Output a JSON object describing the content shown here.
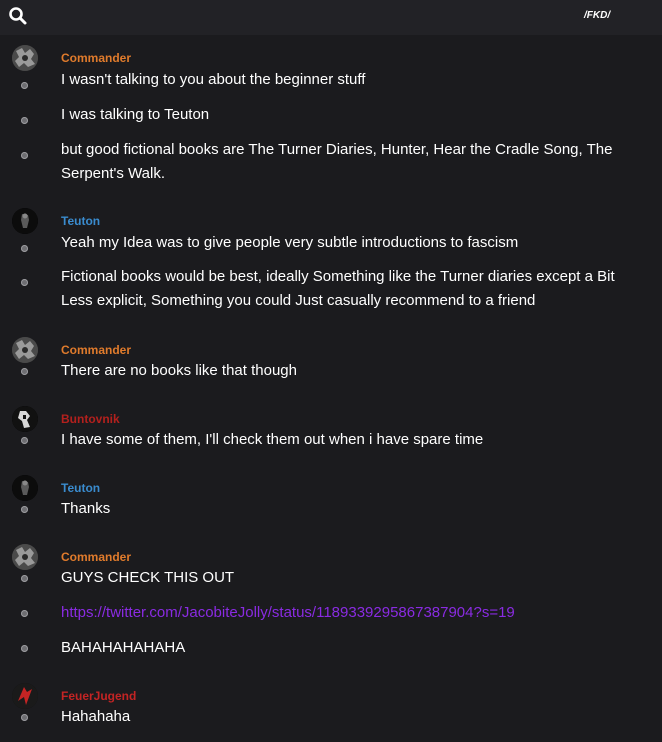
{
  "header": {
    "channel": "/FKD/"
  },
  "colors": {
    "commander": "#e07b2c",
    "teuton": "#3a8ccf",
    "buntovnik": "#b3201d",
    "feuerjugend": "#c42424",
    "link": "#8a2be2"
  },
  "messages": [
    {
      "author": "Commander",
      "lines": [
        "I wasn't talking to you about the beginner stuff",
        "I was talking to Teuton",
        "but good fictional books are The Turner Diaries, Hunter, Hear the Cradle Song, The Serpent's Walk."
      ]
    },
    {
      "author": "Teuton",
      "lines": [
        "Yeah my Idea was to give people very subtle introductions to fascism",
        "Fictional books would be best, ideally Something like the Turner diaries except a Bit Less explicit, Something you could Just casually recommend to a friend"
      ]
    },
    {
      "author": "Commander",
      "lines": [
        "There are no books like that though"
      ]
    },
    {
      "author": "Buntovnik",
      "lines": [
        "I have some of them, I'll check them out when i have spare time"
      ]
    },
    {
      "author": "Teuton",
      "lines": [
        "Thanks"
      ]
    },
    {
      "author": "Commander",
      "lines": [
        "GUYS CHECK THIS OUT",
        "https://twitter.com/JacobiteJolly/status/1189339295867387904?s=19",
        "BAHAHAHAHAHA"
      ]
    },
    {
      "author": "FeuerJugend",
      "lines": [
        "Hahahaha"
      ]
    }
  ]
}
